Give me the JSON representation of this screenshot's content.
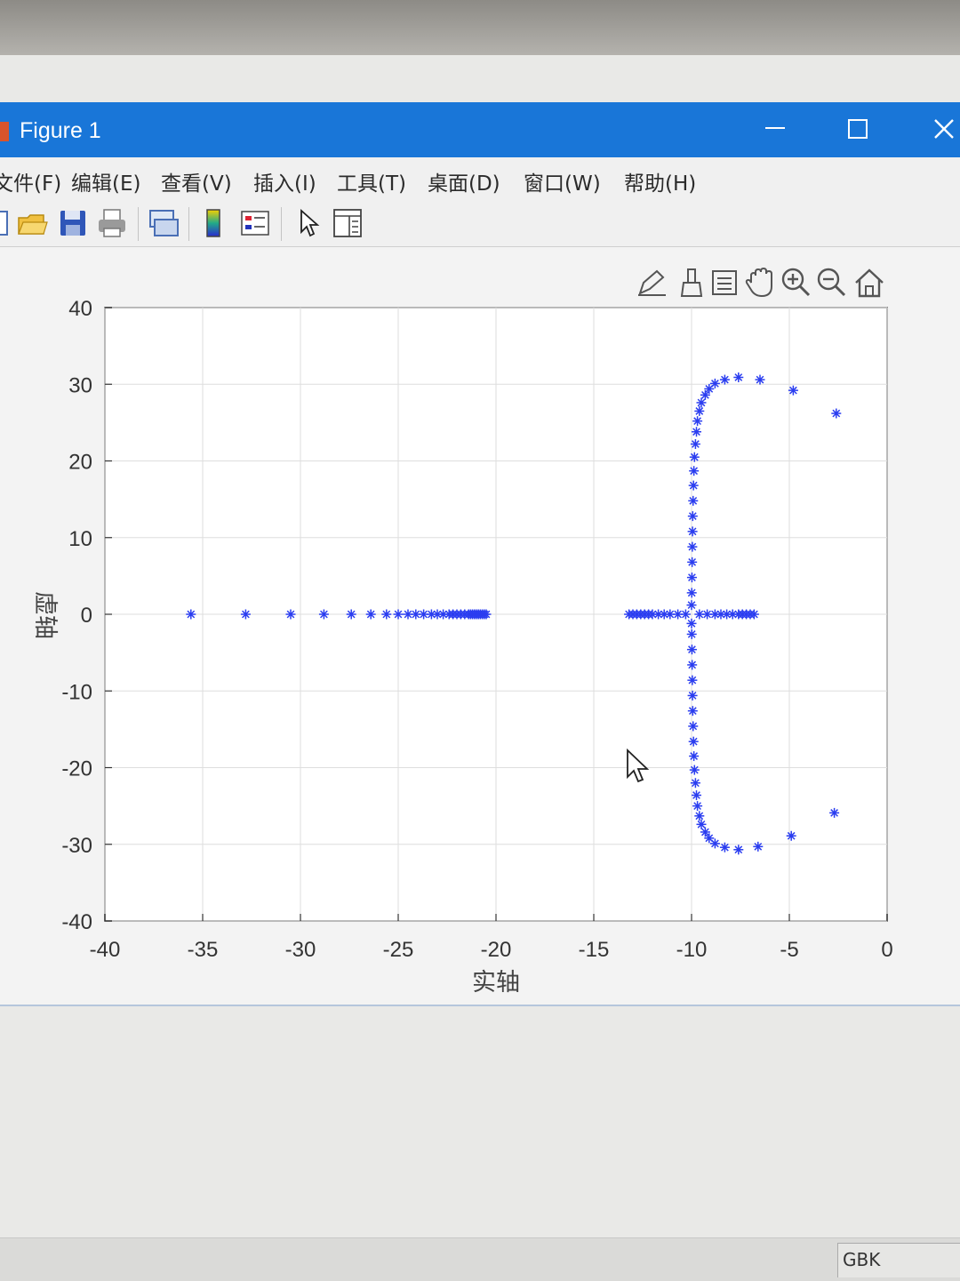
{
  "window": {
    "title": "Figure 1"
  },
  "menu": [
    "文件(F)",
    "编辑(E)",
    "查看(V)",
    "插入(I)",
    "工具(T)",
    "桌面(D)",
    "窗口(W)",
    "帮助(H)"
  ],
  "status": {
    "encoding": "GBK"
  },
  "chart_data": {
    "type": "scatter",
    "marker": "*",
    "color": "#2a3df0",
    "xlabel": "实轴",
    "ylabel": "虚轴",
    "xlim": [
      -40,
      0
    ],
    "ylim": [
      -40,
      40
    ],
    "grid": true,
    "xticks": [
      "-40",
      "-35",
      "-30",
      "-25",
      "-20",
      "-15",
      "-10",
      "-5",
      "0"
    ],
    "yticks": [
      "40",
      "30",
      "20",
      "10",
      "0",
      "-10",
      "-20",
      "-30",
      "-40"
    ],
    "series": [
      {
        "points": [
          [
            -35.6,
            0
          ],
          [
            -32.8,
            0
          ],
          [
            -30.5,
            0
          ],
          [
            -28.8,
            0
          ],
          [
            -27.4,
            0
          ],
          [
            -26.4,
            0
          ],
          [
            -25.6,
            0
          ],
          [
            -25.0,
            0
          ],
          [
            -24.5,
            0
          ],
          [
            -24.1,
            0
          ],
          [
            -23.7,
            0
          ],
          [
            -23.3,
            0
          ],
          [
            -23.0,
            0
          ],
          [
            -22.7,
            0
          ],
          [
            -22.4,
            0
          ],
          [
            -22.2,
            0
          ],
          [
            -22.0,
            0
          ],
          [
            -21.8,
            0
          ],
          [
            -21.6,
            0
          ],
          [
            -21.4,
            0
          ],
          [
            -21.3,
            0
          ],
          [
            -21.2,
            0
          ],
          [
            -21.1,
            0
          ],
          [
            -21.0,
            0
          ],
          [
            -20.9,
            0
          ],
          [
            -20.8,
            0
          ],
          [
            -20.7,
            0
          ],
          [
            -20.6,
            0
          ],
          [
            -20.5,
            0
          ],
          [
            -13.2,
            0
          ],
          [
            -13.0,
            0
          ],
          [
            -12.8,
            0
          ],
          [
            -12.6,
            0
          ],
          [
            -12.4,
            0
          ],
          [
            -12.2,
            0
          ],
          [
            -12.0,
            0
          ],
          [
            -11.7,
            0
          ],
          [
            -11.4,
            0
          ],
          [
            -11.1,
            0
          ],
          [
            -10.7,
            0
          ],
          [
            -10.3,
            0
          ],
          [
            -9.6,
            0
          ],
          [
            -9.2,
            0
          ],
          [
            -8.8,
            0
          ],
          [
            -8.5,
            0
          ],
          [
            -8.2,
            0
          ],
          [
            -7.9,
            0
          ],
          [
            -7.6,
            0
          ],
          [
            -7.4,
            0
          ],
          [
            -7.2,
            0
          ],
          [
            -7.0,
            0
          ],
          [
            -6.8,
            0
          ],
          [
            -2.6,
            26.2
          ],
          [
            -4.8,
            29.2
          ],
          [
            -6.5,
            30.6
          ],
          [
            -7.6,
            30.9
          ],
          [
            -8.3,
            30.6
          ],
          [
            -8.8,
            30.1
          ],
          [
            -9.1,
            29.4
          ],
          [
            -9.3,
            28.6
          ],
          [
            -9.5,
            27.6
          ],
          [
            -9.6,
            26.5
          ],
          [
            -9.7,
            25.2
          ],
          [
            -9.75,
            23.8
          ],
          [
            -9.8,
            22.2
          ],
          [
            -9.85,
            20.5
          ],
          [
            -9.88,
            18.7
          ],
          [
            -9.9,
            16.8
          ],
          [
            -9.92,
            14.8
          ],
          [
            -9.94,
            12.8
          ],
          [
            -9.95,
            10.8
          ],
          [
            -9.96,
            8.8
          ],
          [
            -9.97,
            6.8
          ],
          [
            -9.98,
            4.8
          ],
          [
            -9.99,
            2.8
          ],
          [
            -10.0,
            1.2
          ],
          [
            -2.7,
            -25.9
          ],
          [
            -4.9,
            -28.9
          ],
          [
            -6.6,
            -30.3
          ],
          [
            -7.6,
            -30.7
          ],
          [
            -8.3,
            -30.4
          ],
          [
            -8.8,
            -29.9
          ],
          [
            -9.1,
            -29.2
          ],
          [
            -9.3,
            -28.4
          ],
          [
            -9.5,
            -27.4
          ],
          [
            -9.6,
            -26.3
          ],
          [
            -9.7,
            -25.0
          ],
          [
            -9.75,
            -23.6
          ],
          [
            -9.8,
            -22.0
          ],
          [
            -9.85,
            -20.3
          ],
          [
            -9.88,
            -18.5
          ],
          [
            -9.9,
            -16.6
          ],
          [
            -9.92,
            -14.6
          ],
          [
            -9.94,
            -12.6
          ],
          [
            -9.95,
            -10.6
          ],
          [
            -9.96,
            -8.6
          ],
          [
            -9.97,
            -6.6
          ],
          [
            -9.98,
            -4.6
          ],
          [
            -9.99,
            -2.6
          ],
          [
            -10.0,
            -1.2
          ]
        ]
      }
    ]
  }
}
